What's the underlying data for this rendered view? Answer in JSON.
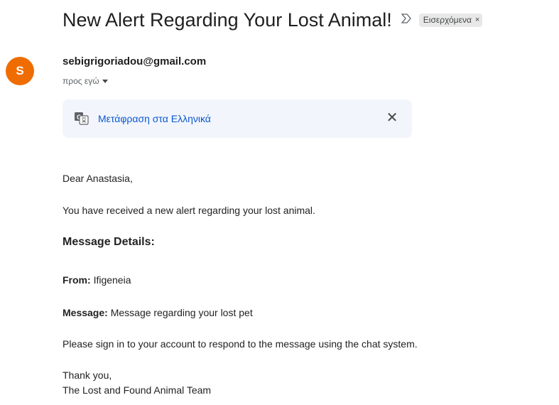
{
  "email": {
    "subject": "New Alert Regarding Your Lost Animal!",
    "label": "Εισερχόμενα",
    "label_close": "×",
    "importance_symbol": "ᐅ",
    "avatar_letter": "S",
    "avatar_color": "#ef6c00",
    "sender": "sebigrigoriadou@gmail.com",
    "recipient": "προς εγώ",
    "translate_label": "Μετάφραση στα Ελληνικά",
    "translate_close": "✕"
  },
  "message": {
    "greeting": "Dear Anastasia,",
    "intro": "You have received a new alert regarding your lost animal.",
    "details_heading": "Message Details:",
    "from_label": "From:",
    "from_value": "Ifigeneia",
    "message_label": "Message:",
    "message_value": "Message regarding your lost pet",
    "instructions": "Please sign in to your account to respond to the message using the chat system.",
    "closing": "Thank you,",
    "signature": "The Lost and Found Animal Team"
  }
}
